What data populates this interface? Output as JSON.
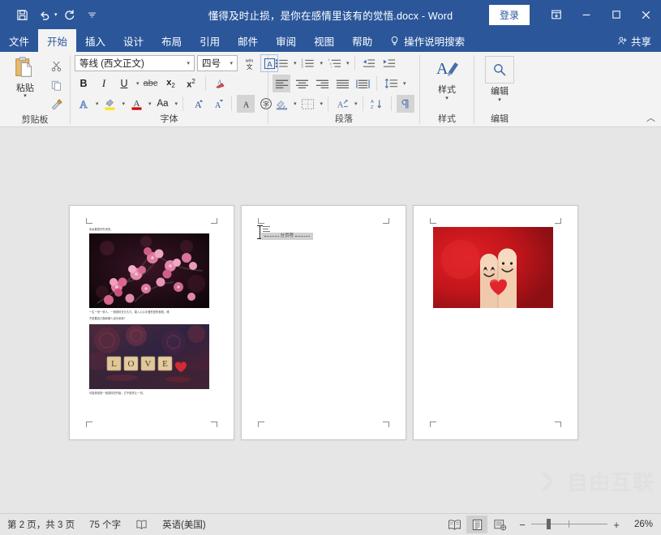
{
  "window": {
    "title": "懂得及时止损，是你在感情里该有的觉悟.docx  -  Word",
    "signin_label": "登录",
    "quick_access": [
      {
        "name": "save-icon",
        "tip": "保存"
      },
      {
        "name": "undo-icon",
        "tip": "撤消"
      },
      {
        "name": "redo-icon",
        "tip": "恢复"
      },
      {
        "name": "customize-qat-icon",
        "tip": "自定义快速访问工具栏"
      }
    ],
    "caption_buttons": [
      {
        "name": "ribbon-display-options-icon"
      },
      {
        "name": "minimize-icon"
      },
      {
        "name": "maximize-icon"
      },
      {
        "name": "close-icon"
      }
    ]
  },
  "tabs": [
    {
      "label": "文件",
      "active": false
    },
    {
      "label": "开始",
      "active": true
    },
    {
      "label": "插入",
      "active": false
    },
    {
      "label": "设计",
      "active": false
    },
    {
      "label": "布局",
      "active": false
    },
    {
      "label": "引用",
      "active": false
    },
    {
      "label": "邮件",
      "active": false
    },
    {
      "label": "审阅",
      "active": false
    },
    {
      "label": "视图",
      "active": false
    },
    {
      "label": "帮助",
      "active": false
    }
  ],
  "tell_me": "操作说明搜索",
  "share_label": "共享",
  "ribbon": {
    "clipboard": {
      "label": "剪贴板",
      "paste_label": "粘贴",
      "buttons": [
        {
          "name": "cut-icon",
          "label": "剪切"
        },
        {
          "name": "copy-icon",
          "label": "复制"
        },
        {
          "name": "format-painter-icon",
          "label": "格式刷"
        }
      ]
    },
    "font": {
      "label": "字体",
      "font_name": "等线 (西文正文)",
      "font_size": "四号",
      "buttons": [
        {
          "name": "phonetic-guide-icon",
          "label": "拼音指南"
        },
        {
          "name": "character-border-icon",
          "label": "字符边框"
        },
        {
          "name": "bold-icon",
          "label": "B"
        },
        {
          "name": "italic-icon",
          "label": "I"
        },
        {
          "name": "underline-icon",
          "label": "U"
        },
        {
          "name": "strikethrough-icon",
          "label": "abc"
        },
        {
          "name": "subscript-icon",
          "label": "x₂"
        },
        {
          "name": "superscript-icon",
          "label": "x²"
        },
        {
          "name": "clear-formatting-icon",
          "label": "清除所有格式"
        },
        {
          "name": "text-effects-icon",
          "label": "A"
        },
        {
          "name": "text-highlight-color-icon",
          "label": "ab"
        },
        {
          "name": "font-color-icon",
          "label": "A"
        },
        {
          "name": "change-case-icon",
          "label": "Aa"
        },
        {
          "name": "grow-font-icon",
          "label": "A"
        },
        {
          "name": "shrink-font-icon",
          "label": "A"
        },
        {
          "name": "character-shading-icon",
          "label": "A"
        },
        {
          "name": "enclose-characters-icon",
          "label": "字"
        }
      ]
    },
    "paragraph": {
      "label": "段落",
      "buttons": [
        {
          "name": "bullets-icon"
        },
        {
          "name": "numbering-icon"
        },
        {
          "name": "multilevel-list-icon"
        },
        {
          "name": "decrease-indent-icon"
        },
        {
          "name": "increase-indent-icon"
        },
        {
          "name": "align-left-icon"
        },
        {
          "name": "align-center-icon"
        },
        {
          "name": "align-right-icon"
        },
        {
          "name": "justify-icon"
        },
        {
          "name": "distributed-icon"
        },
        {
          "name": "line-spacing-icon"
        },
        {
          "name": "shading-icon"
        },
        {
          "name": "borders-icon"
        },
        {
          "name": "chinese-layout-icon"
        },
        {
          "name": "sort-icon"
        },
        {
          "name": "show-formatting-marks-icon"
        }
      ]
    },
    "styles": {
      "label": "样式",
      "button_label": "样式"
    },
    "editing": {
      "label": "编辑",
      "button_label": "编辑",
      "icon": "find-icon"
    },
    "collapse_label": "折叠功能区"
  },
  "document": {
    "pages": [
      {
        "number": 1,
        "paragraphs": [
          {
            "text": "永远都是好先来的。"
          },
          {
            "text": "一生一世一双人，一段感情长久久久，能入心心中爱的是的秘密，难"
          },
          {
            "text": "不是要自己做和爱人自头到老？"
          },
          {
            "text": "可能是双是一段感情的开始，它不是终止一切。"
          }
        ],
        "images": [
          {
            "name": "cherry-blossom-photo",
            "alt": "粉色梅花特写"
          },
          {
            "name": "love-scrabble-photo",
            "alt": "LOVE 字母方块与红心"
          }
        ]
      },
      {
        "number": 2,
        "page_break_label": "分页符",
        "selected": true
      },
      {
        "number": 3,
        "images": [
          {
            "name": "fingers-heart-photo",
            "alt": "两只画着笑脸的手指与红心"
          }
        ]
      }
    ]
  },
  "watermark": {
    "text": "自由互联",
    "logo": "x-logo-icon"
  },
  "status": {
    "page_info": "第 2 页，共 3 页",
    "word_count": "75 个字",
    "proofing_icon": "proofing-errors-icon",
    "language": "英语(美国)",
    "views": [
      {
        "name": "read-mode-icon",
        "label": "阅读视图",
        "active": false
      },
      {
        "name": "print-layout-icon",
        "label": "页面视图",
        "active": true
      },
      {
        "name": "web-layout-icon",
        "label": "Web 版式视图",
        "active": false
      }
    ],
    "zoom_out_label": "−",
    "zoom_in_label": "+",
    "zoom_level": "26%"
  },
  "colors": {
    "brand": "#2b579a",
    "ribbon_bg": "#f3f3f3",
    "canvas_bg": "#e6e6e6",
    "accent_red": "#c0392b"
  }
}
